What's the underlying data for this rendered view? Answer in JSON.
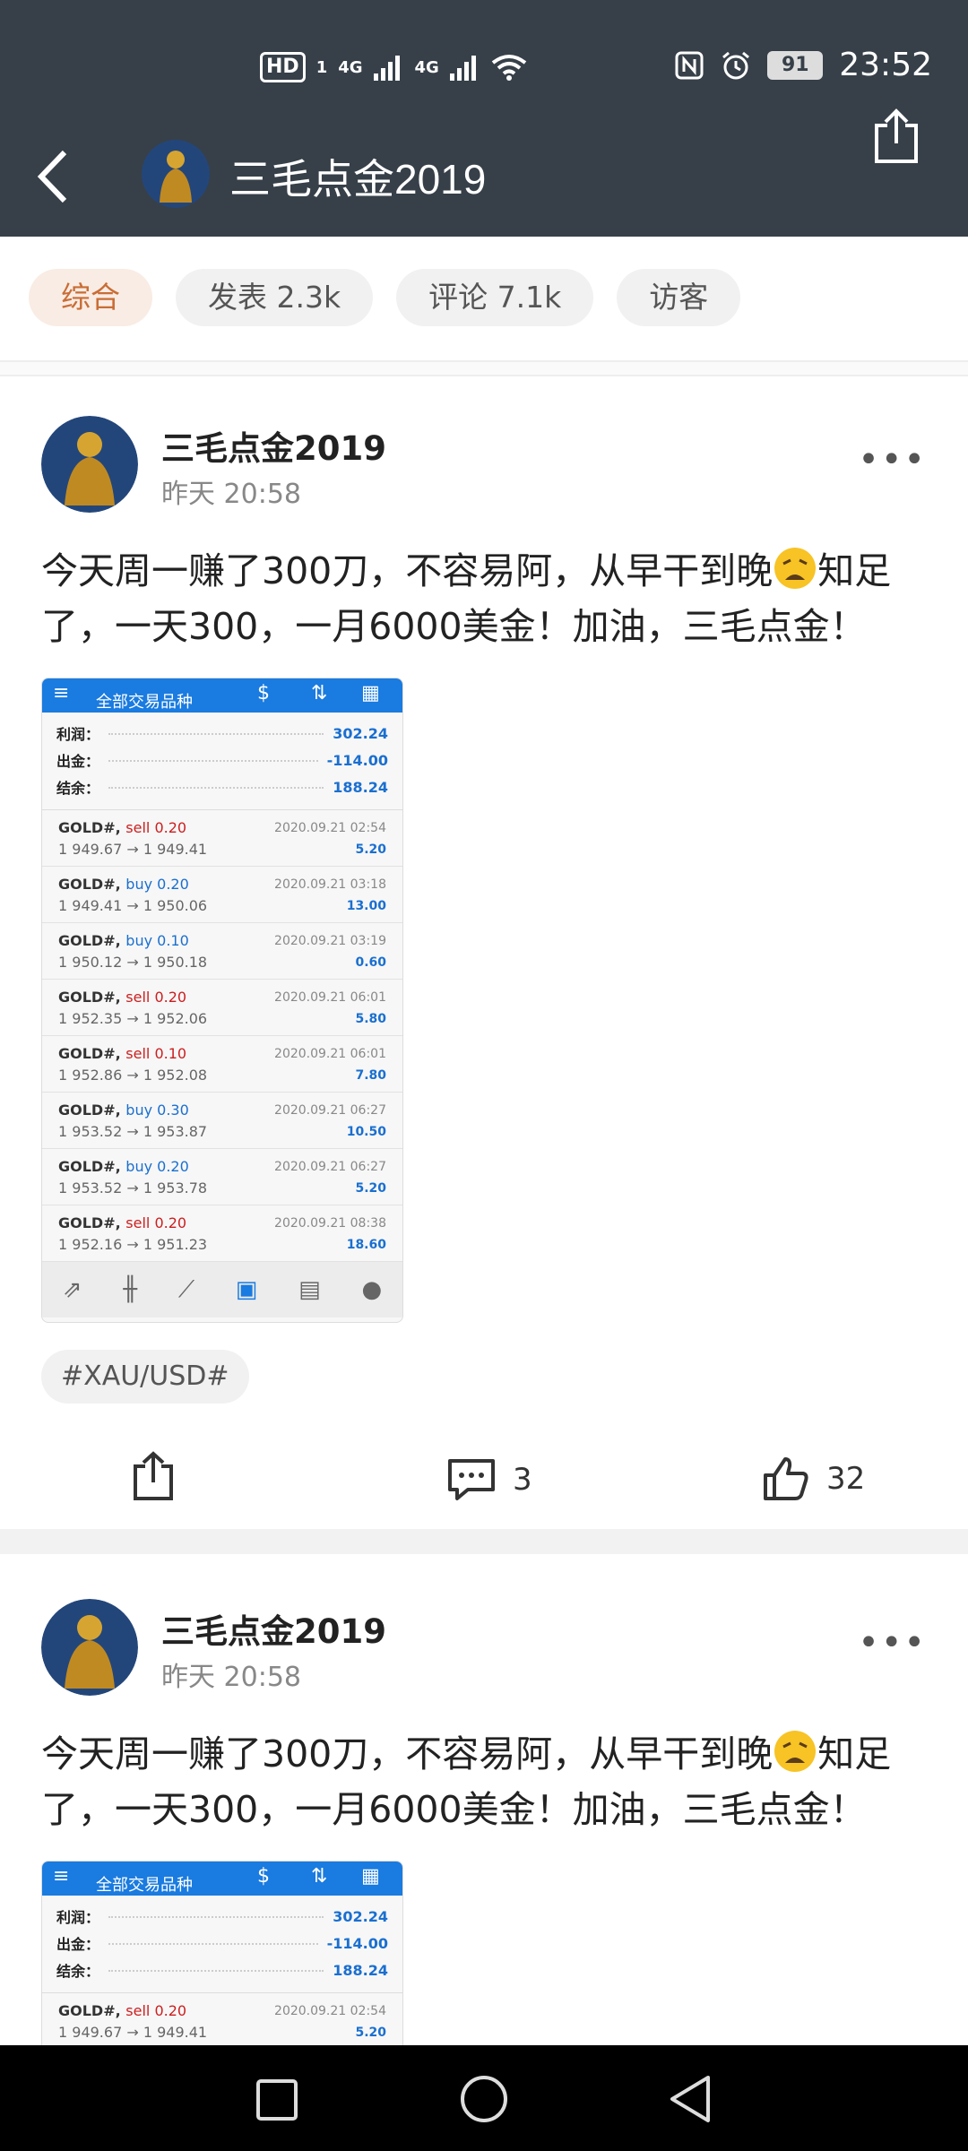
{
  "status": {
    "left": {
      "hd": "HD",
      "sim1": "1",
      "net1": "4G",
      "net2": "4G"
    },
    "right": {
      "battery": "91",
      "time": "23:52"
    }
  },
  "nav": {
    "title": "三毛点金2019"
  },
  "tabs": [
    {
      "label": "综合"
    },
    {
      "label": "发表 2.3k"
    },
    {
      "label": "评论 7.1k"
    },
    {
      "label": "访客"
    }
  ],
  "posts": [
    {
      "author": "三毛点金2019",
      "time": "昨天 20:58",
      "text_a": "今天周一赚了300刀，不容易阿，从早干到晚",
      "text_b": "知足了，一天300，一月6000美金！加油，三毛点金！",
      "tag": "#XAU/USD#",
      "comments": "3",
      "likes": "32"
    },
    {
      "author": "三毛点金2019",
      "time": "昨天 20:58",
      "text_a": "今天周一赚了300刀，不容易阿，从早干到晚",
      "text_b": "知足了，一天300，一月6000美金！加油，三毛点金！"
    }
  ],
  "shot": {
    "header_title": "全部交易品种",
    "summary": [
      {
        "k": "利润：",
        "v": "302.24"
      },
      {
        "k": "出金：",
        "v": "-114.00"
      },
      {
        "k": "结余：",
        "v": "188.24"
      }
    ],
    "trades": [
      {
        "sym": "GOLD#,",
        "side": "sell 0.20",
        "price": "1 949.67 → 1 949.41",
        "dt": "2020.09.21 02:54",
        "pl": "5.20"
      },
      {
        "sym": "GOLD#,",
        "side": "buy 0.20",
        "price": "1 949.41 → 1 950.06",
        "dt": "2020.09.21 03:18",
        "pl": "13.00"
      },
      {
        "sym": "GOLD#,",
        "side": "buy 0.10",
        "price": "1 950.12 → 1 950.18",
        "dt": "2020.09.21 03:19",
        "pl": "0.60"
      },
      {
        "sym": "GOLD#,",
        "side": "sell 0.20",
        "price": "1 952.35 → 1 952.06",
        "dt": "2020.09.21 06:01",
        "pl": "5.80"
      },
      {
        "sym": "GOLD#,",
        "side": "sell 0.10",
        "price": "1 952.86 → 1 952.08",
        "dt": "2020.09.21 06:01",
        "pl": "7.80"
      },
      {
        "sym": "GOLD#,",
        "side": "buy 0.30",
        "price": "1 953.52 → 1 953.87",
        "dt": "2020.09.21 06:27",
        "pl": "10.50"
      },
      {
        "sym": "GOLD#,",
        "side": "buy 0.20",
        "price": "1 953.52 → 1 953.78",
        "dt": "2020.09.21 06:27",
        "pl": "5.20"
      },
      {
        "sym": "GOLD#,",
        "side": "sell 0.20",
        "price": "1 952.16 → 1 951.23",
        "dt": "2020.09.21 08:38",
        "pl": "18.60"
      }
    ]
  },
  "colors": {
    "header_bg": "#374049",
    "accent": "#c96d35",
    "link_blue": "#1a6fd0",
    "sell_red": "#cc1e1e"
  },
  "icons": [
    "back-arrow-icon",
    "share-icon",
    "more-icon",
    "comment-icon",
    "like-icon",
    "recent-apps-icon",
    "home-icon",
    "back-triangle-icon"
  ]
}
